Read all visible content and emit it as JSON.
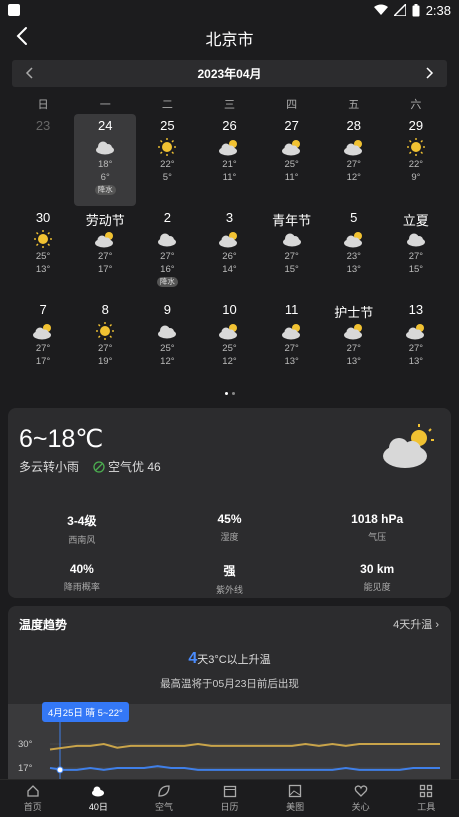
{
  "status": {
    "time": "2:38"
  },
  "header": {
    "title": "北京市"
  },
  "month": {
    "label": "2023年04月"
  },
  "weekdays": [
    "日",
    "一",
    "二",
    "三",
    "四",
    "五",
    "六"
  ],
  "weeks": [
    [
      {
        "d": "23",
        "muted": true,
        "icon": "",
        "hi": "",
        "lo": ""
      },
      {
        "d": "24",
        "sel": true,
        "icon": "cloud",
        "hi": "18°",
        "lo": "6°",
        "badge": "降水"
      },
      {
        "d": "25",
        "icon": "sun",
        "hi": "22°",
        "lo": "5°"
      },
      {
        "d": "26",
        "icon": "partly",
        "hi": "21°",
        "lo": "11°"
      },
      {
        "d": "27",
        "icon": "partly",
        "hi": "25°",
        "lo": "11°"
      },
      {
        "d": "28",
        "icon": "partly",
        "hi": "27°",
        "lo": "12°"
      },
      {
        "d": "29",
        "icon": "sun",
        "hi": "22°",
        "lo": "9°"
      }
    ],
    [
      {
        "d": "30",
        "icon": "sun",
        "hi": "25°",
        "lo": "13°"
      },
      {
        "d": "劳动节",
        "icon": "partly",
        "hi": "27°",
        "lo": "17°"
      },
      {
        "d": "2",
        "icon": "cloud",
        "hi": "27°",
        "lo": "16°",
        "badge": "降水"
      },
      {
        "d": "3",
        "icon": "partly",
        "hi": "26°",
        "lo": "14°"
      },
      {
        "d": "青年节",
        "icon": "cloud",
        "hi": "27°",
        "lo": "15°"
      },
      {
        "d": "5",
        "icon": "partly",
        "hi": "23°",
        "lo": "13°"
      },
      {
        "d": "立夏",
        "icon": "cloud",
        "hi": "27°",
        "lo": "15°"
      }
    ],
    [
      {
        "d": "7",
        "icon": "partly",
        "hi": "27°",
        "lo": "17°"
      },
      {
        "d": "8",
        "icon": "sun",
        "hi": "27°",
        "lo": "19°"
      },
      {
        "d": "9",
        "icon": "cloud",
        "hi": "25°",
        "lo": "12°"
      },
      {
        "d": "10",
        "icon": "partly",
        "hi": "25°",
        "lo": "12°"
      },
      {
        "d": "11",
        "icon": "partly",
        "hi": "27°",
        "lo": "13°"
      },
      {
        "d": "护士节",
        "icon": "partly",
        "hi": "27°",
        "lo": "13°"
      },
      {
        "d": "13",
        "icon": "partly",
        "hi": "27°",
        "lo": "13°"
      }
    ]
  ],
  "today": {
    "range": "6~18℃",
    "condition": "多云转小雨",
    "aqi": "空气优 46",
    "stats": [
      {
        "v": "3-4级",
        "k": "西南风"
      },
      {
        "v": "45%",
        "k": "湿度"
      },
      {
        "v": "1018 hPa",
        "k": "气压"
      },
      {
        "v": "40%",
        "k": "降雨概率"
      },
      {
        "v": "强",
        "k": "紫外线"
      },
      {
        "v": "30 km",
        "k": "能见度"
      }
    ]
  },
  "trend": {
    "title": "温度趋势",
    "link": "4天升温",
    "big_num": "4",
    "big_text": "天3°C以上升温",
    "sub": "最高温将于05月23日前后出现",
    "tooltip": "4月25日 晴 5~22°",
    "y_high": "30°",
    "y_low": "17°"
  },
  "chart_data": {
    "type": "line",
    "title": "",
    "series": [
      {
        "values": [
          27,
          28,
          29,
          29,
          30,
          28,
          29,
          29,
          29,
          29,
          29,
          30,
          29,
          29,
          29,
          29,
          29,
          29,
          29,
          30,
          29,
          30,
          29,
          30,
          30,
          30,
          30,
          30,
          30,
          30
        ]
      },
      {
        "values": [
          17,
          16,
          16,
          17,
          16,
          17,
          17,
          17,
          18,
          17,
          17,
          16,
          16,
          16,
          16,
          16,
          16,
          16,
          16,
          16,
          16,
          16,
          17,
          16,
          16,
          16,
          16,
          17,
          17,
          17
        ]
      }
    ],
    "y_ticks": [
      "30°",
      "17°"
    ],
    "colors": [
      "#c9a44a",
      "#3f7fe8"
    ]
  },
  "tabs": [
    {
      "label": "首页",
      "icon": "home-icon"
    },
    {
      "label": "40日",
      "icon": "cloud-icon",
      "active": true
    },
    {
      "label": "空气",
      "icon": "leaf-icon"
    },
    {
      "label": "日历",
      "icon": "calendar-icon"
    },
    {
      "label": "美图",
      "icon": "image-icon"
    },
    {
      "label": "关心",
      "icon": "heart-icon"
    },
    {
      "label": "工具",
      "icon": "grid-icon"
    }
  ]
}
